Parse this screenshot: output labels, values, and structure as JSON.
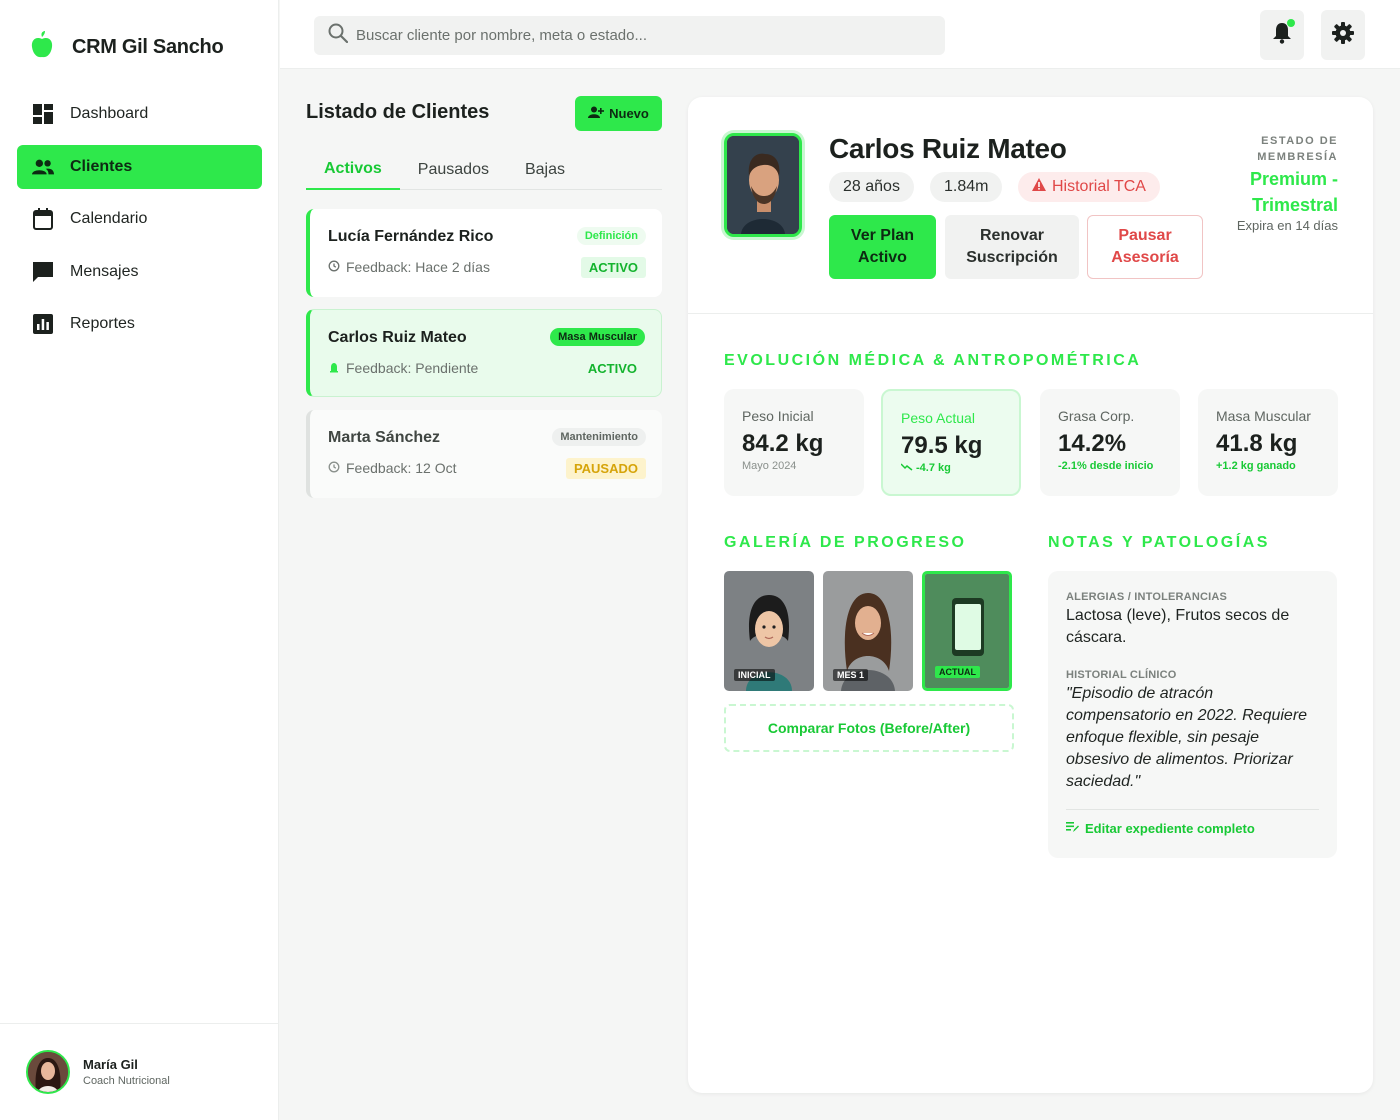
{
  "brand": {
    "name": "CRM Gil Sancho"
  },
  "sidebar": {
    "items": [
      {
        "label": "Dashboard",
        "icon": "dashboard-icon"
      },
      {
        "label": "Clientes",
        "icon": "users-icon",
        "active": true
      },
      {
        "label": "Calendario",
        "icon": "calendar-icon"
      },
      {
        "label": "Mensajes",
        "icon": "chat-icon"
      },
      {
        "label": "Reportes",
        "icon": "chart-icon"
      }
    ]
  },
  "user": {
    "name": "María Gil",
    "role": "Coach Nutricional"
  },
  "search": {
    "placeholder": "Buscar cliente por nombre, meta o estado..."
  },
  "clients_list": {
    "title": "Listado de Clientes",
    "new_label": "Nuevo",
    "tabs": [
      {
        "label": "Activos",
        "active": true
      },
      {
        "label": "Pausados"
      },
      {
        "label": "Bajas"
      }
    ],
    "cards": [
      {
        "name": "Lucía Fernández Rico",
        "feedback": "Feedback: Hace 2 días",
        "tag": "Definición",
        "status": "ACTIVO"
      },
      {
        "name": "Carlos Ruiz Mateo",
        "feedback": "Feedback: Pendiente",
        "tag": "Masa Muscular",
        "status": "ACTIVO",
        "selected": true
      },
      {
        "name": "Marta Sánchez",
        "feedback": "Feedback: 12 Oct",
        "tag": "Mantenimiento",
        "status": "PAUSADO"
      }
    ]
  },
  "detail": {
    "name": "Carlos Ruiz Mateo",
    "age": "28 años",
    "height": "1.84m",
    "alert": "Historial TCA",
    "actions": {
      "view_plan": "Ver Plan Activo",
      "renew": "Renovar Suscripción",
      "pause": "Pausar Asesoría"
    },
    "membership": {
      "label": "ESTADO DE MEMBRESÍA",
      "plan": "Premium - Trimestral",
      "expires": "Expira en 14 días"
    },
    "evolution_title": "EVOLUCIÓN MÉDICA & ANTROPOMÉTRICA",
    "metrics": [
      {
        "label": "Peso Inicial",
        "value": "84.2 kg",
        "sub": "Mayo 2024"
      },
      {
        "label": "Peso Actual",
        "value": "79.5 kg",
        "sub": "-4.7 kg"
      },
      {
        "label": "Grasa Corp.",
        "value": "14.2%",
        "sub": "-2.1% desde inicio"
      },
      {
        "label": "Masa Muscular",
        "value": "41.8 kg",
        "sub": "+1.2 kg ganado"
      }
    ],
    "gallery": {
      "title": "GALERÍA DE PROGRESO",
      "photos": [
        {
          "label": "INICIAL"
        },
        {
          "label": "MES 1"
        },
        {
          "label": "ACTUAL"
        }
      ],
      "compare_label": "Comparar Fotos (Before/After)"
    },
    "notes": {
      "title": "NOTAS Y PATOLOGÍAS",
      "allergies_label": "ALERGIAS / INTOLERANCIAS",
      "allergies": "Lactosa (leve), Frutos secos de cáscara.",
      "history_label": "HISTORIAL CLÍNICO",
      "history": "\"Episodio de atracón compensatorio en 2022. Requiere enfoque flexible, sin pesaje obsesivo de alimentos. Priorizar saciedad.\"",
      "edit_label": "Editar expediente completo"
    }
  },
  "colors": {
    "accent": "#2ee84b",
    "danger": "#e04848",
    "warning": "#d6a40a"
  }
}
